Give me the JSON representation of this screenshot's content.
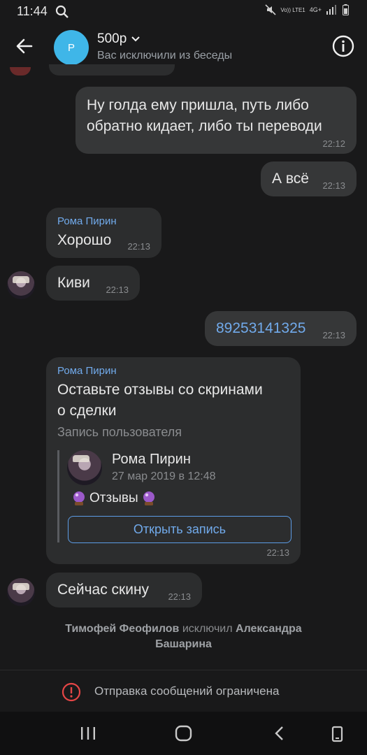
{
  "status": {
    "time": "11:44",
    "network_top": "Vo)) LTE1",
    "network_type": "4G+"
  },
  "header": {
    "avatar_letter": "P",
    "title": "500р",
    "subtitle": "Вас исключили из беседы"
  },
  "messages": [
    {
      "id": "m1",
      "text_line1": "Ну голда ему пришла, путь либо",
      "text_line2": "обратно кидает, либо ты переводи",
      "time": "22:12"
    },
    {
      "id": "m2",
      "text": "А всё",
      "time": "22:13"
    },
    {
      "id": "m3",
      "sender": "Рома Пирин",
      "text": "Хорошо",
      "time": "22:13"
    },
    {
      "id": "m4",
      "text": "Киви",
      "time": "22:13"
    },
    {
      "id": "m5",
      "text": "89253141325",
      "time": "22:13"
    },
    {
      "id": "m6",
      "sender": "Рома Пирин",
      "text_line1": "Оставьте отзывы со скринами",
      "text_line2": "о сделки",
      "attachment_label": "Запись пользователя",
      "post": {
        "author": "Рома Пирин",
        "date": "27 мар 2019 в 12:48",
        "text": "Отзывы",
        "button": "Открыть запись"
      },
      "time": "22:13"
    },
    {
      "id": "m7",
      "text": "Сейчас скину",
      "time": "22:13"
    }
  ],
  "service": {
    "actor": "Тимофей Феофилов",
    "action": "исключил",
    "target_line1": "Александра",
    "target_line2": "Башарина"
  },
  "footer": {
    "restriction": "Отправка сообщений ограничена"
  }
}
